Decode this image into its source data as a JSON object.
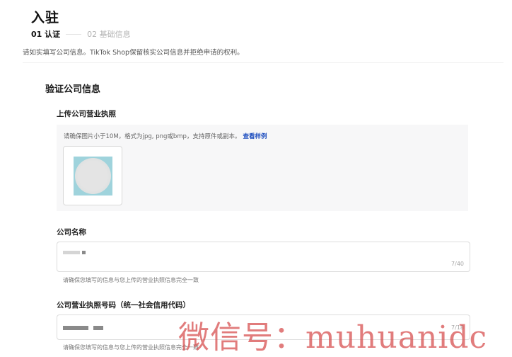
{
  "header": {
    "title": "入驻",
    "steps": [
      {
        "label": "01 认证",
        "active": true
      },
      {
        "label": "02 基础信息",
        "active": false
      }
    ],
    "notice": "请如实填写公司信息。TikTok Shop保留核实公司信息并拒绝申请的权利。"
  },
  "section": {
    "title": "验证公司信息"
  },
  "license_upload": {
    "label": "上传公司营业执照",
    "hint": "请确保图片小于10M，格式为jpg, png或bmp，支持原件或副本。",
    "link": "查看样例"
  },
  "company_name": {
    "label": "公司名称",
    "counter": "7/40",
    "helper": "请确保您填写的信息与您上传的营业执照信息完全一致"
  },
  "license_number": {
    "label": "公司营业执照号码（统一社会信用代码）",
    "counter": "7/18",
    "helper": "请确保您填写的信息与您上传的营业执照信息完全一致"
  },
  "watermark": {
    "text": "微信号：muhuanidc"
  },
  "colors": {
    "link": "#1f4fbf",
    "watermark": "#d64a4a",
    "thumbnail_bg": "#9fd3dc"
  }
}
